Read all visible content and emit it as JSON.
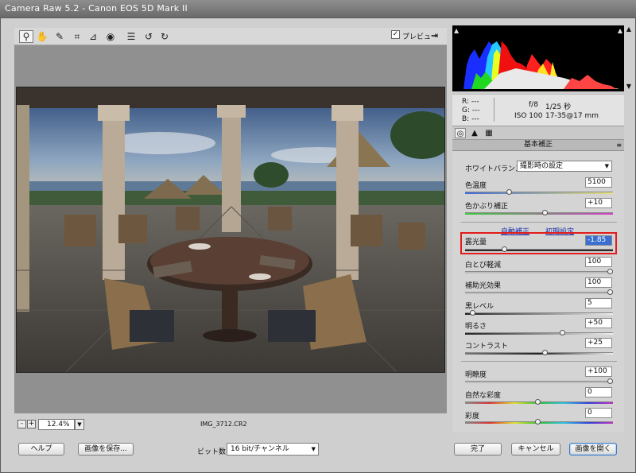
{
  "window": {
    "title": "Camera Raw 5.2  -  Canon EOS 5D Mark II"
  },
  "toolbar": {
    "tools": [
      {
        "name": "zoom-tool-icon",
        "glyph": "⚲"
      },
      {
        "name": "hand-tool-icon",
        "glyph": "✋"
      },
      {
        "name": "white-balance-tool-icon",
        "glyph": "✎"
      },
      {
        "name": "crop-tool-icon",
        "glyph": "⌗"
      },
      {
        "name": "straighten-tool-icon",
        "glyph": "⊿"
      },
      {
        "name": "red-eye-tool-icon",
        "glyph": "◉"
      },
      {
        "name": "preferences-icon",
        "glyph": "☰"
      },
      {
        "name": "rotate-left-icon",
        "glyph": "↺"
      },
      {
        "name": "rotate-right-icon",
        "glyph": "↻"
      }
    ],
    "preview_checked": "✓",
    "preview_label": "プレビュー",
    "fullscreen_glyph": "⇥"
  },
  "status": {
    "zoom_minus": "-",
    "zoom_plus": "+",
    "zoom_value": "12.4%",
    "zoom_arrow": "▼",
    "filename": "IMG_3712.CR2"
  },
  "bottom": {
    "help": "ヘルプ",
    "save": "画像を保存...",
    "bit_label": "ビット数：",
    "bit_value": "16 bit/チャンネル",
    "select_arrow": "▼",
    "done": "完了",
    "cancel": "キャンセル",
    "open": "画像を開く"
  },
  "histogram": {
    "clip_shadow": "▲",
    "clip_highlight": "▲"
  },
  "info": {
    "r": "R:   ---",
    "g": "G:   ---",
    "b": "B:   ---",
    "aperture": "f/8",
    "shutter": "1/25 秒",
    "iso": "ISO 100",
    "lens": "17-35@17 mm"
  },
  "scroll": {
    "up": "▲",
    "down": "▼"
  },
  "panel": {
    "title": "基本補正",
    "menu_glyph": "≡",
    "tabs": [
      "◎",
      "▲",
      "▦"
    ],
    "white_balance_label": "ホワイトバランス：",
    "white_balance_value": "撮影時の設定",
    "auto_link": "自動補正",
    "default_link": "初期設定",
    "sliders": [
      {
        "label": "色温度",
        "value": "5100",
        "pos": 0.3
      },
      {
        "label": "色かぶり補正",
        "value": "+10",
        "pos": 0.55
      },
      {
        "label": "露光量",
        "value": "-1.85",
        "pos": 0.27
      },
      {
        "label": "白とび軽減",
        "value": "100",
        "pos": 1.0
      },
      {
        "label": "補助光効果",
        "value": "100",
        "pos": 1.0
      },
      {
        "label": "黒レベル",
        "value": "5",
        "pos": 0.05
      },
      {
        "label": "明るさ",
        "value": "+50",
        "pos": 0.67
      },
      {
        "label": "コントラスト",
        "value": "+25",
        "pos": 0.55
      },
      {
        "label": "明瞭度",
        "value": "+100",
        "pos": 1.0
      },
      {
        "label": "自然な彩度",
        "value": "0",
        "pos": 0.5
      },
      {
        "label": "彩度",
        "value": "0",
        "pos": 0.5
      }
    ]
  }
}
